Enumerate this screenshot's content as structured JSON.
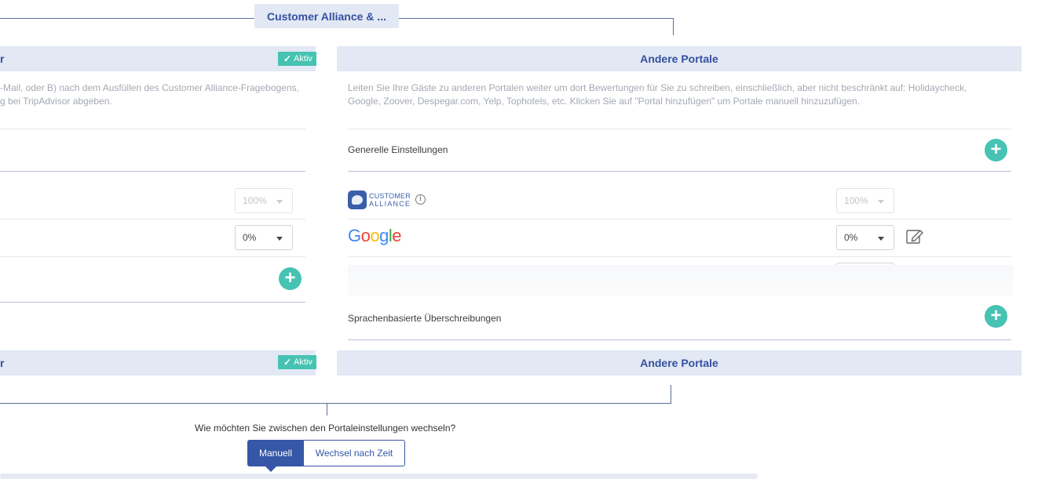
{
  "flow": {
    "top_label": "Customer Alliance & ..."
  },
  "left_panel": {
    "title_fragment": "r",
    "badge": "Aktiv",
    "description_line1": "-Mail, oder B) nach dem Ausfüllen des Customer Alliance-Fragebogens,",
    "description_line2": "g bei TripAdvisor abgeben.",
    "rows": [
      {
        "percent": "100%",
        "disabled": true
      },
      {
        "percent": "0%",
        "disabled": false
      }
    ]
  },
  "right_panel": {
    "title": "Andere Portale",
    "description_line1": "Leiten Sie Ihre Gäste zu anderen Portalen weiter um dort Bewertungen für Sie zu schreiben, einschließlich, aber nicht beschränkt auf: Holidaycheck,",
    "description_line2": "Google, Zoover, Despegar.com, Yelp, Tophotels, etc. Klicken Sie auf \"Portal hinzufügen\" um Portale manuell hinzuzufügen.",
    "general_settings": "Generelle Einstellungen",
    "portals": [
      {
        "logo_line1": "CUSTOMER",
        "logo_line2": "ALLIANCE",
        "percent": "100%",
        "disabled": true
      },
      {
        "logo": "Google",
        "percent": "0%",
        "disabled": false
      }
    ],
    "language_overrides": "Sprachenbasierte Überschreibungen"
  },
  "second_row": {
    "left_title_fragment": "r",
    "left_badge": "Aktiv",
    "right_title": "Andere Portale"
  },
  "switch": {
    "question": "Wie möchten Sie zwischen den Portaleinstellungen wechseln?",
    "options": [
      "Manuell",
      "Wechsel nach Zeit"
    ],
    "selected": "Manuell"
  },
  "colors": {
    "accent": "#46c3b2",
    "primary": "#3656a6",
    "header_bg": "#e2e8f4"
  }
}
